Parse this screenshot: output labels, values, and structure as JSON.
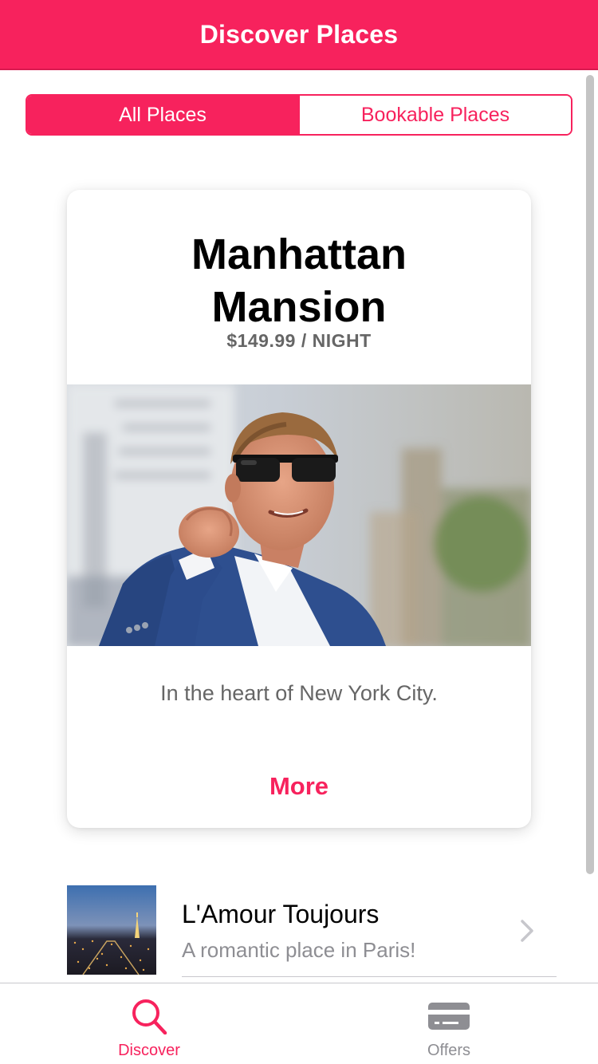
{
  "header": {
    "title": "Discover Places"
  },
  "segment": {
    "all_label": "All Places",
    "bookable_label": "Bookable Places",
    "selected": "All Places"
  },
  "featured": {
    "title_line1": "Manhattan",
    "title_line2": "Mansion",
    "price": "$149.99 / NIGHT",
    "description": "In the heart of New York City.",
    "more_label": "More"
  },
  "list": [
    {
      "title": "L'Amour Toujours",
      "subtitle": "A romantic place in Paris!"
    }
  ],
  "tabs": [
    {
      "label": "Discover",
      "icon": "search-icon",
      "active": true
    },
    {
      "label": "Offers",
      "icon": "card-icon",
      "active": false
    }
  ],
  "colors": {
    "accent": "#f7225d",
    "muted": "#8e8e93",
    "text_gray": "#666666"
  }
}
